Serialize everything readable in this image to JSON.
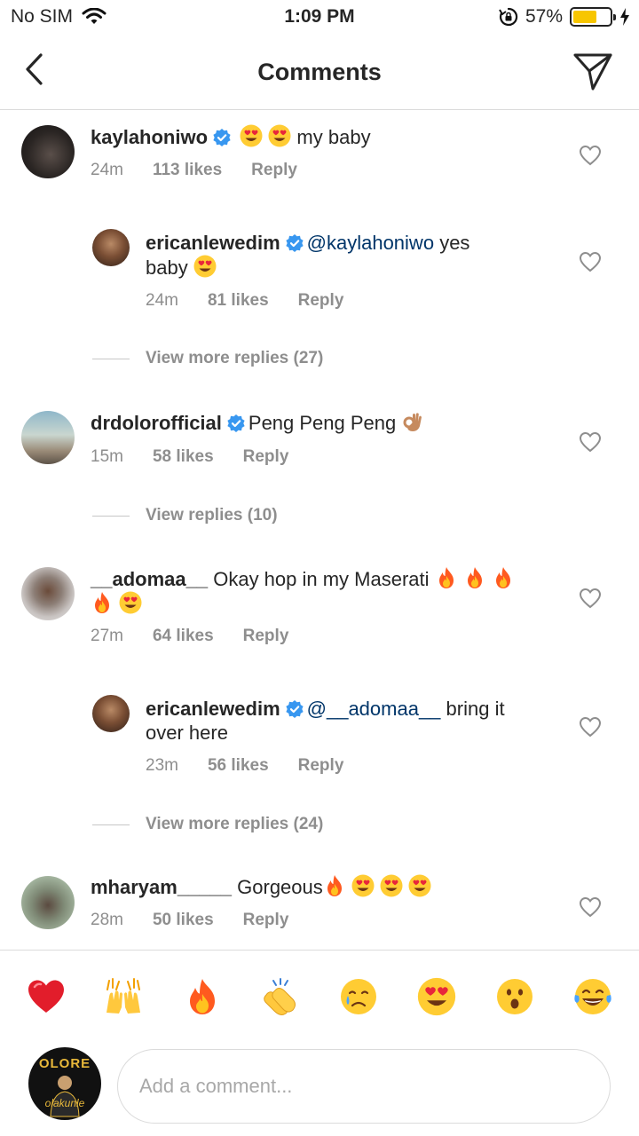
{
  "status_bar": {
    "carrier": "No SIM",
    "time": "1:09 PM",
    "battery": "57%"
  },
  "header": {
    "title": "Comments"
  },
  "comments": [
    {
      "username": "kaylahoniwo",
      "verified": true,
      "text": "my baby",
      "time": "24m",
      "likes": "113 likes",
      "reply": "Reply"
    },
    {
      "username": "ericanlewedim",
      "verified": true,
      "mention": "@kaylahoniwo",
      "text_line1": "yes",
      "text_line2": "baby",
      "time": "24m",
      "likes": "81 likes",
      "reply": "Reply"
    },
    {
      "username": "drdolorofficial",
      "verified": true,
      "text": "Peng Peng Peng",
      "time": "15m",
      "likes": "58 likes",
      "reply": "Reply"
    },
    {
      "username": "__adomaa__",
      "verified": false,
      "text": "Okay hop in my Maserati",
      "time": "27m",
      "likes": "64 likes",
      "reply": "Reply"
    },
    {
      "username": "ericanlewedim",
      "verified": true,
      "mention": "@__adomaa__",
      "text_line1": "bring it",
      "text_line2": "over here",
      "time": "23m",
      "likes": "56 likes",
      "reply": "Reply"
    },
    {
      "username": "mharyam_____",
      "verified": false,
      "text": "Gorgeous",
      "time": "28m",
      "likes": "50 likes",
      "reply": "Reply"
    }
  ],
  "replies_links": {
    "first": "View more replies (27)",
    "second": "View replies (10)",
    "third": "View more replies (24)"
  },
  "reactions": [
    "heart",
    "raised-hands",
    "fire",
    "clapping-hands",
    "crying-face",
    "heart-eyes",
    "surprised-face",
    "tears-of-joy"
  ],
  "composer": {
    "placeholder": "Add a comment...",
    "avatar_text": "OLORE",
    "avatar_subtext": "olakunle"
  },
  "colors": {
    "verified": "#3897f0",
    "mention": "#003569",
    "fire": "#ff6a00",
    "battery": "#f7c600"
  }
}
